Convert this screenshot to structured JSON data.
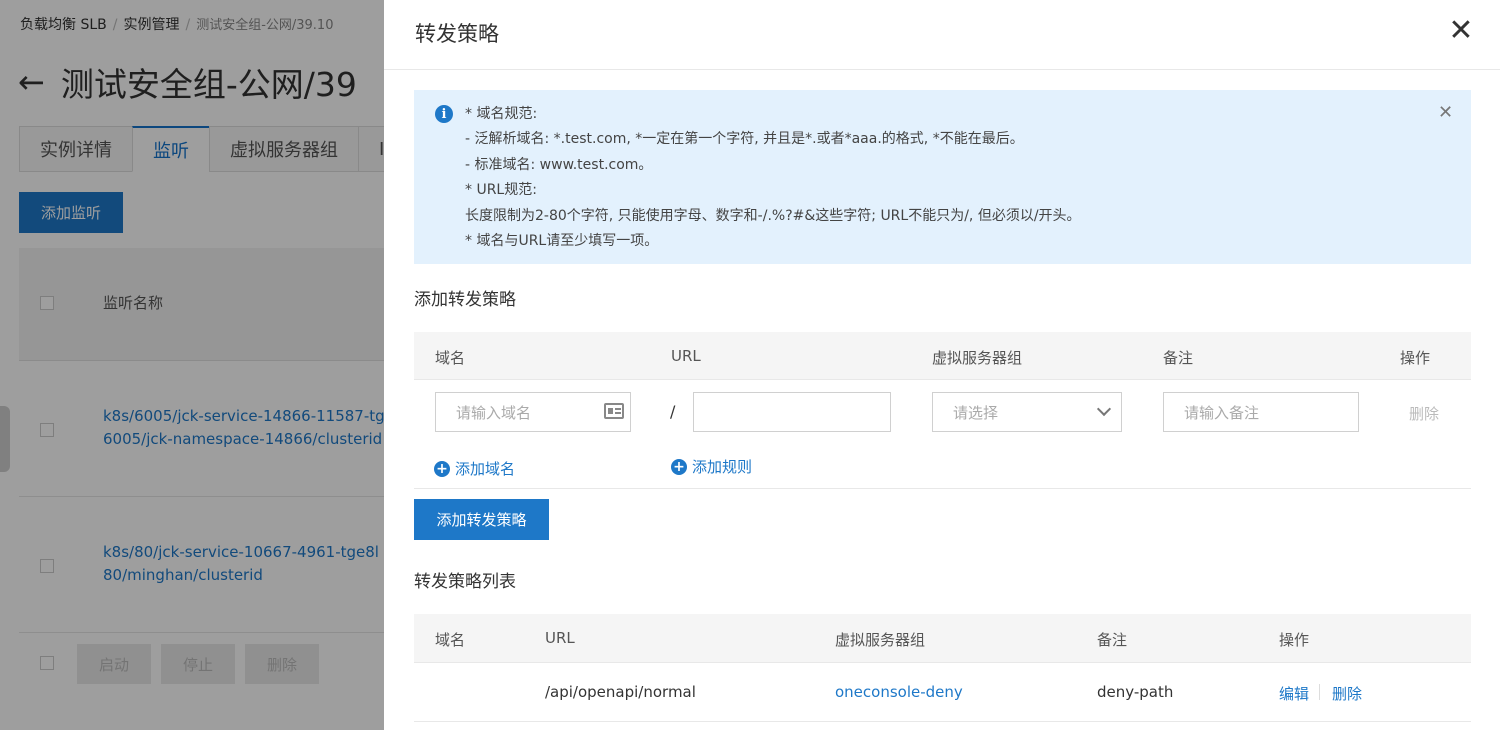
{
  "background": {
    "breadcrumb": [
      "负载均衡 SLB",
      "实例管理",
      "测试安全组-公网/39.10"
    ],
    "page_title": "测试安全组-公网/39",
    "back_icon": "arrow-left-icon",
    "tabs": [
      {
        "label": "实例详情",
        "active": false
      },
      {
        "label": "监听",
        "active": true
      },
      {
        "label": "虚拟服务器组",
        "active": false
      },
      {
        "label": "I",
        "active": false
      }
    ],
    "add_listener_label": "添加监听",
    "table_header": "监听名称",
    "rows": [
      {
        "line1": "k8s/6005/jck-service-14866-11587-tg",
        "line2": "6005/jck-namespace-14866/clusterid"
      },
      {
        "line1": "k8s/80/jck-service-10667-4961-tge8l",
        "line2": "80/minghan/clusterid"
      }
    ],
    "bulk_actions": [
      "启动",
      "停止",
      "删除"
    ]
  },
  "drawer": {
    "title": "转发策略",
    "close_icon": "close-icon",
    "notice": {
      "icon": "info-icon",
      "lines": [
        "* 域名规范:",
        "- 泛解析域名: *.test.com, *一定在第一个字符, 并且是*.或者*aaa.的格式, *不能在最后。",
        "- 标准域名: www.test.com。",
        "* URL规范:",
        "长度限制为2-80个字符, 只能使用字母、数字和-/.%?#&这些字符; URL不能只为/, 但必须以/开头。",
        "* 域名与URL请至少填写一项。"
      ],
      "close_icon": "close-icon"
    },
    "add_section_title": "添加转发策略",
    "form": {
      "headers": {
        "domain": "域名",
        "url": "URL",
        "server_group": "虚拟服务器组",
        "remark": "备注",
        "action": "操作"
      },
      "domain_placeholder": "请输入域名",
      "url_prefix": "/",
      "url_value": "",
      "server_group_placeholder": "请选择",
      "remark_placeholder": "请输入备注",
      "delete_label": "删除",
      "add_domain_label": "添加域名",
      "add_rule_label": "添加规则"
    },
    "add_policy_button": "添加转发策略",
    "list_section_title": "转发策略列表",
    "list": {
      "headers": {
        "domain": "域名",
        "url": "URL",
        "server_group": "虚拟服务器组",
        "remark": "备注",
        "action": "操作"
      },
      "rows": [
        {
          "domain": "",
          "url": "/api/openapi/normal",
          "server_group": "oneconsole-deny",
          "remark": "deny-path",
          "edit": "编辑",
          "delete": "删除"
        }
      ]
    }
  },
  "colors": {
    "accent": "#1e78c8",
    "notice_bg": "#e3f1fd",
    "overlay": "rgba(0,0,0,0.38)"
  }
}
